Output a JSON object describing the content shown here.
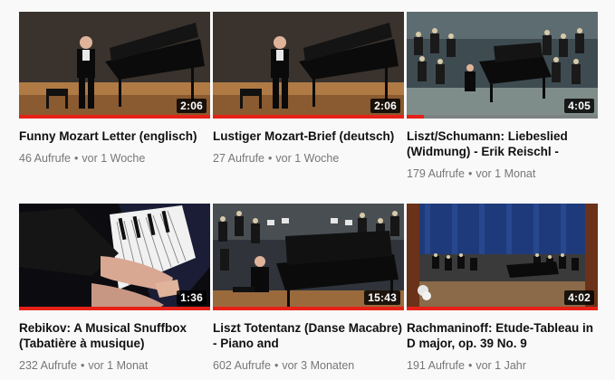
{
  "colors": {
    "progress": "#e62117",
    "title": "#111111",
    "meta": "#777777",
    "background": "#f9f9f9"
  },
  "separator": "•",
  "videos": [
    {
      "title": "Funny Mozart Letter (englisch)",
      "views": "46 Aufrufe",
      "age": "vor 1 Woche",
      "duration": "2:06",
      "watched_fraction": 1.0,
      "thumbnail": "man-speaking-at-piano"
    },
    {
      "title": "Lustiger Mozart-Brief (deutsch)",
      "views": "27 Aufrufe",
      "age": "vor 1 Woche",
      "duration": "2:06",
      "watched_fraction": 1.0,
      "thumbnail": "man-speaking-at-piano"
    },
    {
      "title": "Liszt/Schumann: Liebeslied (Widmung) - Erik Reischl -",
      "views": "179 Aufrufe",
      "age": "vor 1 Monat",
      "duration": "4:05",
      "watched_fraction": 0.09,
      "thumbnail": "piano-with-orchestra"
    },
    {
      "title": "Rebikov: A Musical Snuffbox (Tabatière à musique)",
      "views": "232 Aufrufe",
      "age": "vor 1 Monat",
      "duration": "1:36",
      "watched_fraction": 1.0,
      "thumbnail": "hands-on-keyboard"
    },
    {
      "title": "Liszt Totentanz (Danse Macabre) - Piano and",
      "views": "602 Aufrufe",
      "age": "vor 3 Monaten",
      "duration": "15:43",
      "watched_fraction": 1.0,
      "thumbnail": "pianist-with-orchestra"
    },
    {
      "title": "Rachmaninoff: Etude-Tableau in D major, op. 39 No. 9",
      "views": "191 Aufrufe",
      "age": "vor 1 Jahr",
      "duration": "4:02",
      "watched_fraction": 1.0,
      "thumbnail": "concert-hall-stage"
    }
  ]
}
